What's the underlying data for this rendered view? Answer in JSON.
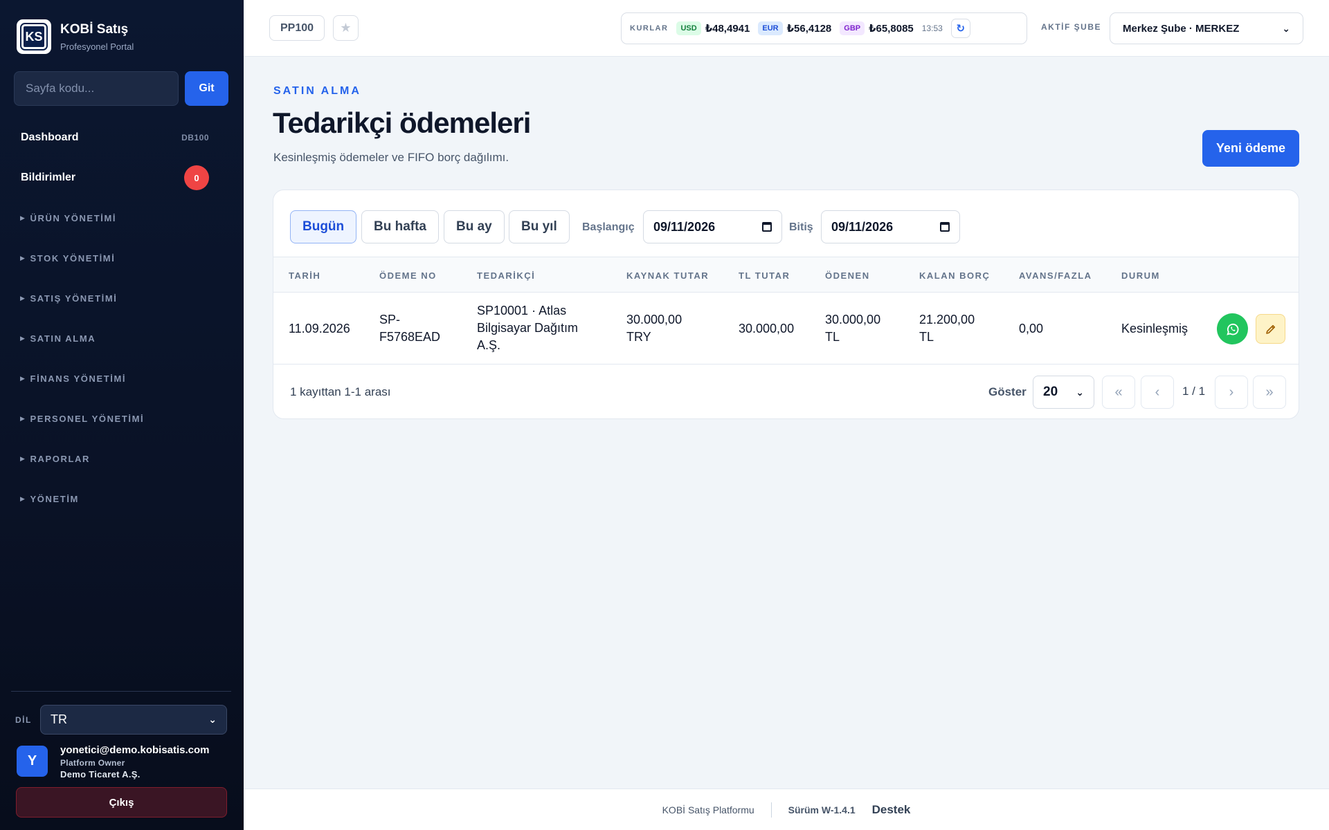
{
  "sidebar": {
    "brand_title": "KOBİ Satış",
    "brand_subtitle": "Profesyonel Portal",
    "logo_text": "KS",
    "page_code_placeholder": "Sayfa kodu...",
    "go_label": "Git",
    "nav": {
      "dashboard_label": "Dashboard",
      "dashboard_code": "DB100",
      "notifications_label": "Bildirimler",
      "notifications_count": "0"
    },
    "groups": [
      "ÜRÜN YÖNETİMİ",
      "STOK YÖNETİMİ",
      "SATIŞ YÖNETİMİ",
      "SATIN ALMA",
      "FİNANS YÖNETİMİ",
      "PERSONEL YÖNETİMİ",
      "RAPORLAR",
      "YÖNETİM"
    ],
    "lang_label": "DİL",
    "lang_value": "TR",
    "user": {
      "initial": "Y",
      "email": "yonetici@demo.kobisatis.com",
      "role": "Platform Owner",
      "company": "Demo Ticaret A.Ş."
    },
    "logout_label": "Çıkış"
  },
  "topbar": {
    "page_code": "PP100",
    "rates_label": "KURLAR",
    "rates": [
      {
        "code": "USD",
        "value": "₺48,4941",
        "bg": "#dcfce7",
        "fg": "#15803d"
      },
      {
        "code": "EUR",
        "value": "₺56,4128",
        "bg": "#dbeafe",
        "fg": "#1d4ed8"
      },
      {
        "code": "GBP",
        "value": "₺65,8085",
        "bg": "#f3e8ff",
        "fg": "#7e22ce"
      }
    ],
    "rate_time": "13:53",
    "branch_label": "AKTİF ŞUBE",
    "branch_value": "Merkez Şube · MERKEZ"
  },
  "main": {
    "eyebrow": "SATIN ALMA",
    "title": "Tedarikçi ödemeleri",
    "description": "Kesinleşmiş ödemeler ve FIFO borç dağılımı.",
    "new_button": "Yeni ödeme",
    "filters": {
      "today": "Bugün",
      "week": "Bu hafta",
      "month": "Bu ay",
      "year": "Bu yıl",
      "start_label": "Başlangıç",
      "start_value": "09/11/2026",
      "end_label": "Bitiş",
      "end_value": "09/11/2026"
    },
    "columns": [
      "TARİH",
      "ÖDEME NO",
      "TEDARİKÇİ",
      "KAYNAK TUTAR",
      "TL TUTAR",
      "ÖDENEN",
      "KALAN BORÇ",
      "AVANS/FAZLA",
      "DURUM"
    ],
    "rows": [
      {
        "date": "11.09.2026",
        "payment_no": "SP-F5768EAD",
        "supplier": "SP10001 · Atlas Bilgisayar Dağıtım A.Ş.",
        "source_amount": "30.000,00 TRY",
        "tl_amount": "30.000,00",
        "paid": "30.000,00 TL",
        "remaining_debt": "21.200,00 TL",
        "advance": "0,00",
        "status": "Kesinleşmiş"
      }
    ],
    "footer": {
      "record_count": "1 kayıttan 1-1 arası",
      "show_label": "Göster",
      "page_size": "20",
      "page_info": "1 / 1",
      "first": "«",
      "prev": "‹",
      "next": "›",
      "last": "»"
    }
  },
  "footer": {
    "platform": "KOBİ Satış Platformu",
    "version": "Sürüm W-1.4.1",
    "support": "Destek"
  },
  "colors": {
    "accent": "#2563eb",
    "sidebar_bg": "#0b1730",
    "danger": "#ef4444",
    "whatsapp": "#22c55e"
  }
}
